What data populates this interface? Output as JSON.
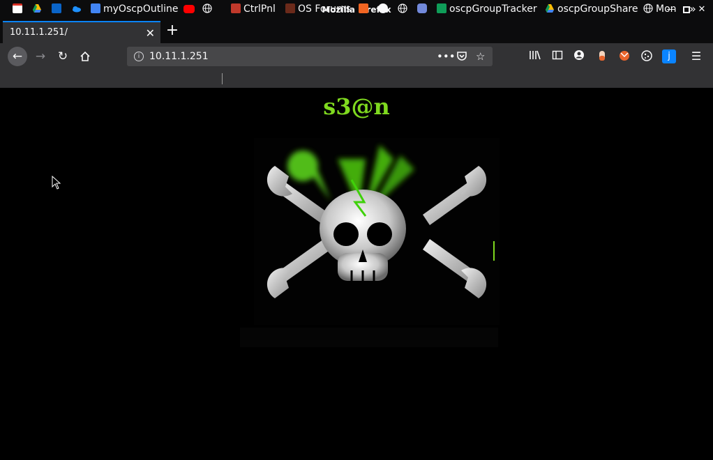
{
  "window": {
    "title": "Mozilla Firefox"
  },
  "tab": {
    "title": "10.11.1.251/"
  },
  "urlbar": {
    "url": "10.11.1.251"
  },
  "bookmarks": [
    {
      "label": "",
      "icon": "gmail-icon"
    },
    {
      "label": "",
      "icon": "google-drive-icon"
    },
    {
      "label": "",
      "icon": "outlook-icon"
    },
    {
      "label": "",
      "icon": "onedrive-icon"
    },
    {
      "label": "myOscpOutline",
      "icon": "google-docs-icon"
    },
    {
      "label": "",
      "icon": "youtube-icon"
    },
    {
      "label": "",
      "icon": "globe-icon"
    },
    {
      "label": "CtrlPnl",
      "icon": "ctrlpnl-icon"
    },
    {
      "label": "OS Forums",
      "icon": "forums-icon"
    },
    {
      "label": "",
      "icon": "bolt-icon"
    },
    {
      "label": "",
      "icon": "github-icon"
    },
    {
      "label": "",
      "icon": "globe-icon"
    },
    {
      "label": "",
      "icon": "discord-icon"
    },
    {
      "label": "oscpGroupTracker",
      "icon": "google-sheets-icon"
    },
    {
      "label": "oscpGroupShare",
      "icon": "google-drive-icon"
    },
    {
      "label": "Mon",
      "icon": "globe-icon"
    }
  ],
  "page": {
    "heading": "s3@n"
  },
  "colors": {
    "accent": "#7fd91f",
    "chrome": "#323234",
    "titlebar": "#0c0c0d",
    "tab_highlight": "#0a84ff"
  }
}
